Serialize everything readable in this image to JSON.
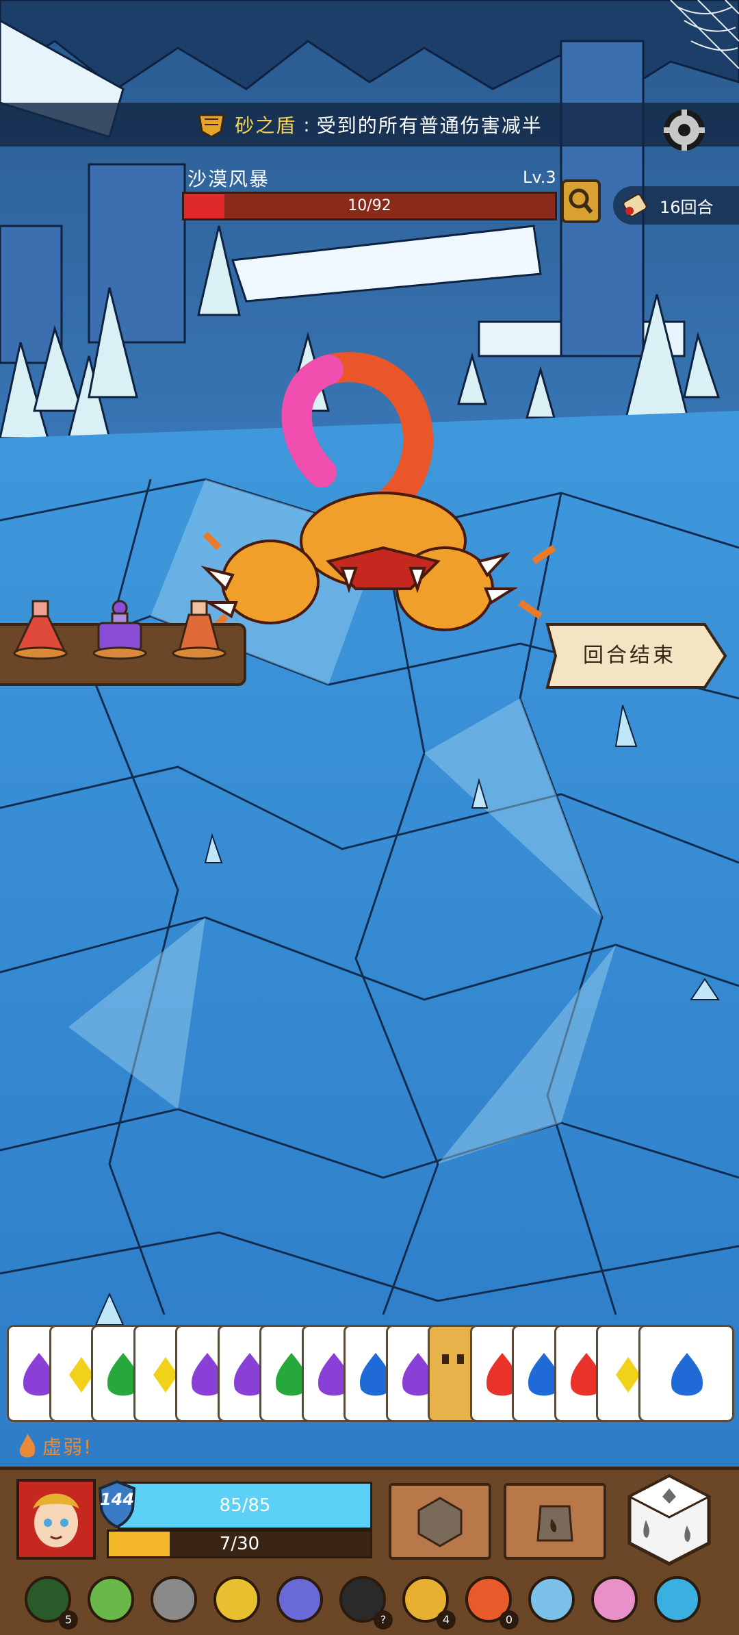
{
  "banner": {
    "title": "砂之盾",
    "separator": ":",
    "text": "受到的所有普通伤害减半",
    "icon": "sand-shield-icon"
  },
  "settings": {
    "icon": "gear-icon"
  },
  "enemy": {
    "name": "沙漠风暴",
    "level": "Lv.3",
    "hp_text": "10/92",
    "hp_current": 10,
    "hp_max": 92
  },
  "round": {
    "text": "16回合",
    "icon": "scroll-icon"
  },
  "end_turn": {
    "label": "回合结束"
  },
  "potions": [
    {
      "name": "red-potion",
      "color": "#e04a3a"
    },
    {
      "name": "purple-potion",
      "color": "#8a4ed6"
    },
    {
      "name": "orange-potion",
      "color": "#e06a3a"
    }
  ],
  "cards": [
    {
      "symbol": "drop",
      "color": "#8a3fd6"
    },
    {
      "symbol": "diamond",
      "color": "#f2d11a"
    },
    {
      "symbol": "drop",
      "color": "#27a83a"
    },
    {
      "symbol": "diamond",
      "color": "#f2d11a"
    },
    {
      "symbol": "drop",
      "color": "#8a3fd6"
    },
    {
      "symbol": "drop",
      "color": "#8a3fd6"
    },
    {
      "symbol": "drop",
      "color": "#27a83a"
    },
    {
      "symbol": "drop",
      "color": "#8a3fd6"
    },
    {
      "symbol": "drop",
      "color": "#1f6ad6"
    },
    {
      "symbol": "drop",
      "color": "#8a3fd6"
    },
    {
      "symbol": "face",
      "color": "#e8b24a"
    },
    {
      "symbol": "drop",
      "color": "#e8322a"
    },
    {
      "symbol": "drop",
      "color": "#1f6ad6"
    },
    {
      "symbol": "drop",
      "color": "#e8322a"
    },
    {
      "symbol": "diamond",
      "color": "#f2d11a"
    },
    {
      "symbol": "drop",
      "color": "#1f6ad6"
    }
  ],
  "status": {
    "text": "虚弱!",
    "icon": "flame-icon"
  },
  "player": {
    "shield": "144",
    "hp_text": "85/85",
    "energy_text": "7/30",
    "energy_current": 7,
    "energy_max": 30
  },
  "relics": [
    {
      "name": "green-ring-icon",
      "count": "5"
    },
    {
      "name": "leaf-icon",
      "count": ""
    },
    {
      "name": "stone-gear-icon",
      "count": ""
    },
    {
      "name": "golden-helmet-icon",
      "count": ""
    },
    {
      "name": "blue-claw-icon",
      "count": ""
    },
    {
      "name": "magic-hat-icon",
      "count": "?"
    },
    {
      "name": "gold-bag-icon",
      "count": "4"
    },
    {
      "name": "fire-mask-icon",
      "count": "0"
    },
    {
      "name": "horn-icon",
      "count": ""
    },
    {
      "name": "pink-d20-icon",
      "count": ""
    },
    {
      "name": "blue-gem-icon",
      "count": ""
    }
  ]
}
